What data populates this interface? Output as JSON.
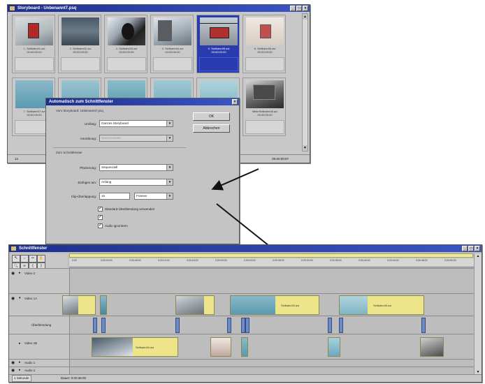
{
  "storyboard": {
    "title": "Storyboard - Unbenannt7.psq",
    "row1": [
      {
        "label": "1. Seilbahn01.avi",
        "time": "00:00:00:00"
      },
      {
        "label": "2. Seilbahn02.avi",
        "time": "00:00:00:00"
      },
      {
        "label": "3. Seilbahn03.avi",
        "time": "00:00:00:00"
      },
      {
        "label": "4. Seilbahn04.avi",
        "time": "00:00:00:00"
      },
      {
        "label": "5. Seilbahn05.avi",
        "time": "00:00:00:00"
      },
      {
        "label": "6. Seilbahn06.avi",
        "time": "00:00:00:00"
      }
    ],
    "row2": [
      {
        "label": "7. Seilbahn07.avi",
        "time": "00:00:00:00"
      },
      {
        "label": "",
        "time": ""
      },
      {
        "label": "",
        "time": ""
      },
      {
        "label": "",
        "time": ""
      },
      {
        "label": "",
        "time": ""
      },
      {
        "label": "Mitte/Seilbahn08.avi",
        "time": "00:00:00:00"
      }
    ],
    "status_left": "12",
    "status_right": "00:00:00:07"
  },
  "dialog": {
    "title": "Automatisch zum Schnittfenster",
    "from_section": "Vom Storyboard: Unbenannt7.psq",
    "umfang_label": "Umfang:",
    "umfang_value": "Ganzes Storyboard",
    "anordnung_label": "Anordnung:",
    "anordnung_value": "Nacheinander",
    "to_section": "Zum Schnittfenster",
    "plazierung_label": "Platzierung:",
    "plazierung_value": "Sequenziell",
    "einfuegen_label": "Einfügen am:",
    "einfuegen_value": "Anfang",
    "ueberlappung_label": "Clip-Überlappung:",
    "ueberlappung_value": "15",
    "ueberlappung_unit": "Frames",
    "ok_label": "OK",
    "cancel_label": "Abbrechen",
    "chk1_label": "Standard-Überblendung verwenden",
    "chk2_label": "",
    "chk3_label": "Audio ignorieren"
  },
  "timeline": {
    "title": "Schnittfenster",
    "ruler_ticks": [
      "0:00",
      "0:00:04:00",
      "0:00:08:00",
      "0:00:12:00",
      "0:00:16:00",
      "0:00:20:00",
      "0:00:24:00",
      "0:00:28:00",
      "0:00:32:00",
      "0:00:36:00",
      "0:00:40:00",
      "0:00:44:00",
      "0:00:48:00",
      "0:00:52:00"
    ],
    "tracks": {
      "video2": "Video 2",
      "video1a": "Video 1A",
      "transition": "Überblendung",
      "video1b": "Video 1B",
      "audio1": "Audio 1",
      "audio2": "Audio 2"
    },
    "clips": {
      "a1": "Seilbahn03.avi",
      "a2": "Seilbahn05.avi",
      "b1": "Seilbahn04.avi"
    },
    "status_zoom": "1 Sekunde",
    "status_info": "Dauer: 0:00:36:00"
  },
  "colors": {
    "titlebar": "#1e2f8c",
    "selected_card": "#2a3bb0",
    "clip_yellow": "#eee48a",
    "transition_blue": "#6c8cc8"
  }
}
